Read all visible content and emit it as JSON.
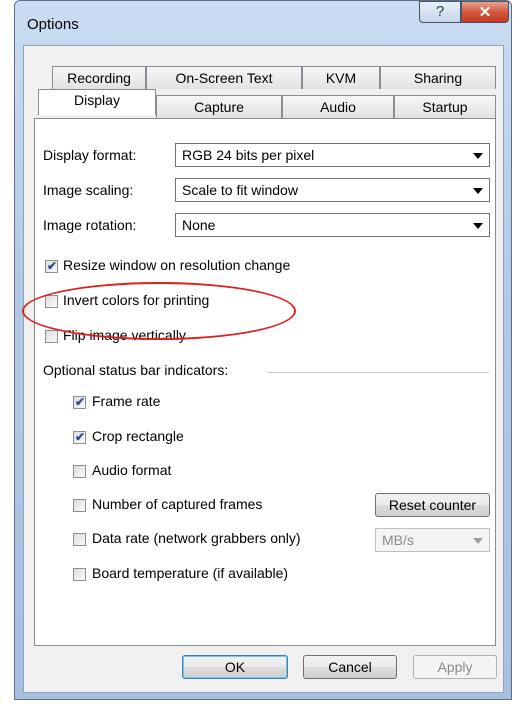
{
  "window": {
    "title": "Options",
    "help_glyph": "?",
    "close_glyph": "✕"
  },
  "tabs_back": [
    "Recording",
    "On-Screen Text",
    "KVM",
    "Sharing"
  ],
  "tabs_front": [
    "Display",
    "Capture",
    "Audio",
    "Startup"
  ],
  "display": {
    "format_label": "Display format:",
    "format_value": "RGB 24 bits per pixel",
    "scaling_label": "Image scaling:",
    "scaling_value": "Scale to fit window",
    "rotation_label": "Image rotation:",
    "rotation_value": "None",
    "resize_label": "Resize window on resolution change",
    "invert_label": "Invert colors for printing",
    "flip_label": "Flip image vertically"
  },
  "indicators": {
    "header": "Optional status bar indicators:",
    "frame_rate": "Frame rate",
    "crop": "Crop rectangle",
    "audio_format": "Audio format",
    "captured_frames": "Number of captured frames",
    "reset_counter": "Reset counter",
    "data_rate": "Data rate (network grabbers only)",
    "data_rate_unit": "MB/s",
    "board_temp": "Board temperature (if available)"
  },
  "checks": {
    "resize": true,
    "invert": false,
    "flip": false,
    "frame_rate": true,
    "crop": true,
    "audio_format": false,
    "captured_frames": false,
    "data_rate": false,
    "board_temp": false
  },
  "buttons": {
    "ok": "OK",
    "cancel": "Cancel",
    "apply": "Apply"
  },
  "colors": {
    "annotation": "#e0201b",
    "check_mark": "#2a4c93",
    "title_bar": "#b3c9e6"
  }
}
